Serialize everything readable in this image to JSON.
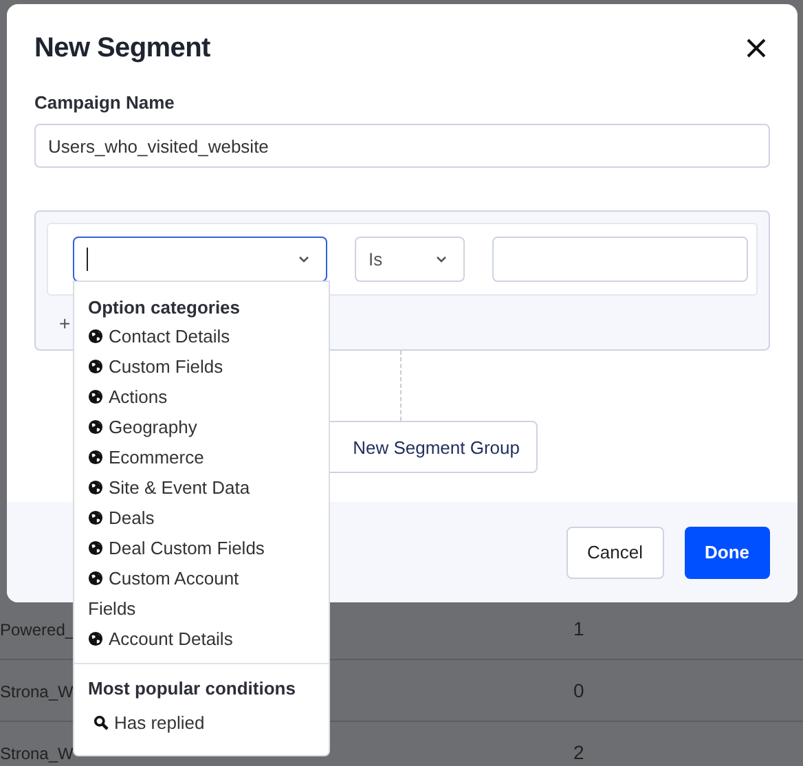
{
  "background_rows": [
    {
      "name": "Powered_",
      "count": "1"
    },
    {
      "name": "Strona_W",
      "count": "0"
    },
    {
      "name": "Strona_W",
      "count": "2"
    }
  ],
  "dialog": {
    "title": "New Segment",
    "field": {
      "label": "Campaign Name",
      "value": "Users_who_visited_website"
    },
    "condition": {
      "field_select": {
        "focused": true
      },
      "operator": {
        "value": "Is"
      }
    },
    "add_condition": "+",
    "add_group_button": "New Segment Group",
    "buttons": [
      {
        "label": "Cancel",
        "kind": "secondary"
      },
      {
        "label": "Done",
        "kind": "primary"
      }
    ]
  },
  "dropdown": {
    "sections": [
      {
        "title": "Option categories",
        "items": [
          {
            "label": "Contact Details",
            "kind": "category"
          },
          {
            "label": "Custom Fields",
            "kind": "category"
          },
          {
            "label": "Actions",
            "kind": "category"
          },
          {
            "label": "Geography",
            "kind": "category"
          },
          {
            "label": "Ecommerce",
            "kind": "category"
          },
          {
            "label": "Site & Event Data",
            "kind": "category"
          },
          {
            "label": "Deals",
            "kind": "category"
          },
          {
            "label": "Deal Custom Fields",
            "kind": "category"
          },
          {
            "label": "Custom Account Fields",
            "kind": "category"
          },
          {
            "label": "Account Details",
            "kind": "category"
          }
        ]
      },
      {
        "title": "Most popular conditions",
        "items": [
          {
            "label": "Has replied",
            "kind": "condition"
          }
        ]
      }
    ]
  }
}
